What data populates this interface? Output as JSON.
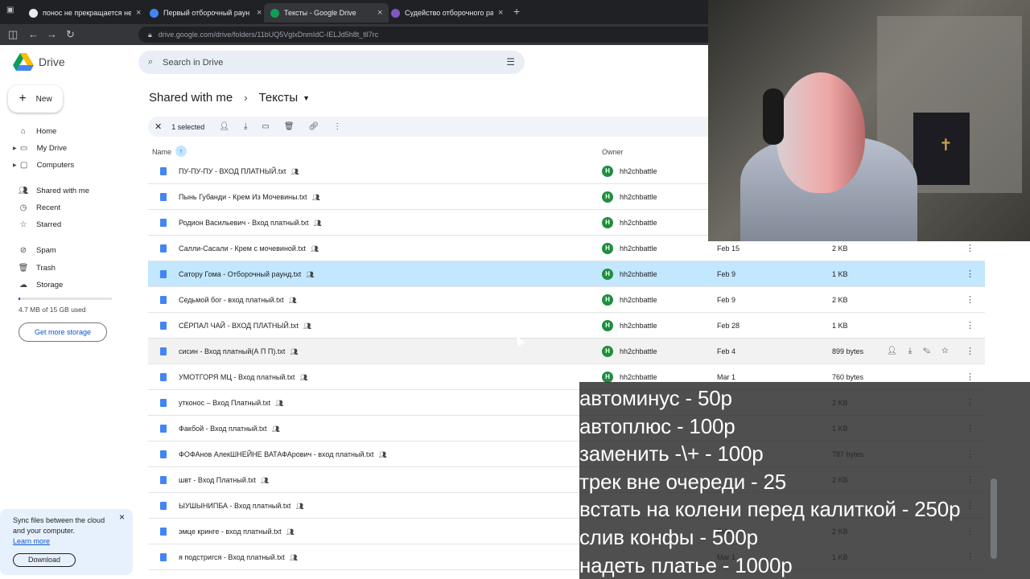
{
  "browser": {
    "tabs": [
      {
        "title": "понос не прекращается неде",
        "favicon_color": "#e8eaed",
        "active": false
      },
      {
        "title": "Первый отборочный раун",
        "favicon_color": "#4285f4",
        "active": false
      },
      {
        "title": "Тексты - Google Drive",
        "favicon_color": "#0f9d58",
        "active": true
      },
      {
        "title": "Судейство отборочного раунд",
        "favicon_color": "#7e57c2",
        "active": false
      }
    ],
    "url": "drive.google.com/drive/folders/11bUQ5VglxDnmIdC-IELJd5h8t_tll7rc"
  },
  "drive": {
    "logo_label": "Drive",
    "search_placeholder": "Search in Drive",
    "new_label": "New",
    "nav": [
      {
        "label": "Home",
        "icon": "home-icon"
      },
      {
        "label": "My Drive",
        "icon": "drive-icon"
      },
      {
        "label": "Computers",
        "icon": "computer-icon"
      },
      {
        "label": "Shared with me",
        "icon": "people-icon"
      },
      {
        "label": "Recent",
        "icon": "clock-icon"
      },
      {
        "label": "Starred",
        "icon": "star-icon"
      },
      {
        "label": "Spam",
        "icon": "spam-icon"
      },
      {
        "label": "Trash",
        "icon": "trash-icon"
      },
      {
        "label": "Storage",
        "icon": "cloud-icon"
      }
    ],
    "storage_used": "4.7 MB of 15 GB used",
    "storage_fraction": 0.02,
    "get_storage": "Get more storage",
    "breadcrumb": {
      "parent": "Shared with me",
      "current": "Тексты"
    },
    "selection": {
      "label": "1 selected"
    },
    "columns": {
      "name": "Name",
      "owner": "Owner"
    },
    "files": [
      {
        "name": "ПУ-ПУ-ПУ - ВХОД ПЛАТНЫЙ.txt",
        "owner": "hh2chbattle",
        "date": "",
        "size": ""
      },
      {
        "name": "Пынь Губанди - Крем Из Мочевины.txt",
        "owner": "hh2chbattle",
        "date": "",
        "size": ""
      },
      {
        "name": "Родион Васильевич - Вход платный.txt",
        "owner": "hh2chbattle",
        "date": "",
        "size": ""
      },
      {
        "name": "Салли-Сасали - Крем с мочевиной.txt",
        "owner": "hh2chbattle",
        "date": "Feb 15",
        "size": "2 KB"
      },
      {
        "name": "Сатору Гома - Отборочный раунд.txt",
        "owner": "hh2chbattle",
        "date": "Feb 9",
        "size": "1 KB"
      },
      {
        "name": "Седьмой бог - вход платный.txt",
        "owner": "hh2chbattle",
        "date": "Feb 9",
        "size": "2 KB"
      },
      {
        "name": "СЁРПАЛ ЧАЙ - ВХОД ПЛАТНЫЙ.txt",
        "owner": "hh2chbattle",
        "date": "Feb 28",
        "size": "1 KB"
      },
      {
        "name": "сисин - Вход платный(А П П).txt",
        "owner": "hh2chbattle",
        "date": "Feb 4",
        "size": "899 bytes"
      },
      {
        "name": "УМОТГОРЯ МЦ - Вход платный.txt",
        "owner": "hh2chbattle",
        "date": "Mar 1",
        "size": "760 bytes"
      },
      {
        "name": "утконос – Вход Платный.txt",
        "owner": "",
        "date": "",
        "size": "2 KB"
      },
      {
        "name": "Факбой - Вход платный.txt",
        "owner": "",
        "date": "",
        "size": "1 KB"
      },
      {
        "name": "ФОФАнов АлекШНЕЙНЕ ВАТАФАрович - вход платный.txt",
        "owner": "",
        "date": "",
        "size": "787 bytes"
      },
      {
        "name": "швт - Вход Платный.txt",
        "owner": "",
        "date": "",
        "size": "2 KB"
      },
      {
        "name": "ЫУШЫНИПБА - Вход платный.txt",
        "owner": "",
        "date": "",
        "size": ""
      },
      {
        "name": "эмце кринге - вход платный.txt",
        "owner": "",
        "date": "Feb",
        "size": "2 KB"
      },
      {
        "name": "я подстригся - Вход платный.txt",
        "owner": "",
        "date": "Mar 1",
        "size": "1 KB"
      }
    ],
    "sync_card": {
      "text": "Sync files between the cloud and your computer.",
      "learn_more": "Learn more",
      "download": "Download"
    }
  },
  "overlay": {
    "lines": [
      "автоминус - 50р",
      "автоплюс - 100р",
      "заменить -\\+ - 100р",
      "трек вне очереди - 25",
      "встать на колени перед калиткой - 250р",
      "слив конфы - 500р",
      "надеть платье - 1000р"
    ]
  }
}
